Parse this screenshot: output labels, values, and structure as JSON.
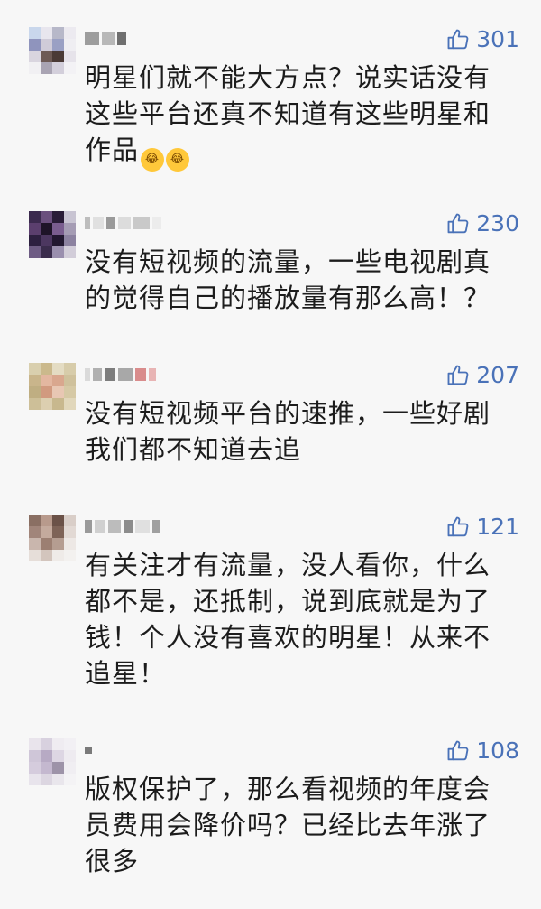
{
  "comments": [
    {
      "likes": "301",
      "text": "明星们就不能大方点？说实话没有这些平台还真不知道有这些明星和作品",
      "emojis": [
        "😂",
        "😂"
      ]
    },
    {
      "likes": "230",
      "text": "没有短视频的流量，一些电视剧真的觉得自己的播放量有那么高！？"
    },
    {
      "likes": "207",
      "text": "没有短视频平台的速推，一些好剧我们都不知道去追"
    },
    {
      "likes": "121",
      "text": "有关注才有流量，没人看你，什么都不是，还抵制，说到底就是为了钱！个人没有喜欢的明星！从来不追星！"
    },
    {
      "likes": "108",
      "text": "版权保护了，那么看视频的年度会员费用会降价吗？已经比去年涨了很多"
    }
  ],
  "icons": {
    "like": "thumbs-up-icon",
    "emoji": "laughing-crying-emoji"
  },
  "colors": {
    "background": "#f7f7f7",
    "like": "#4a72b8",
    "text": "#1c1c1c"
  }
}
